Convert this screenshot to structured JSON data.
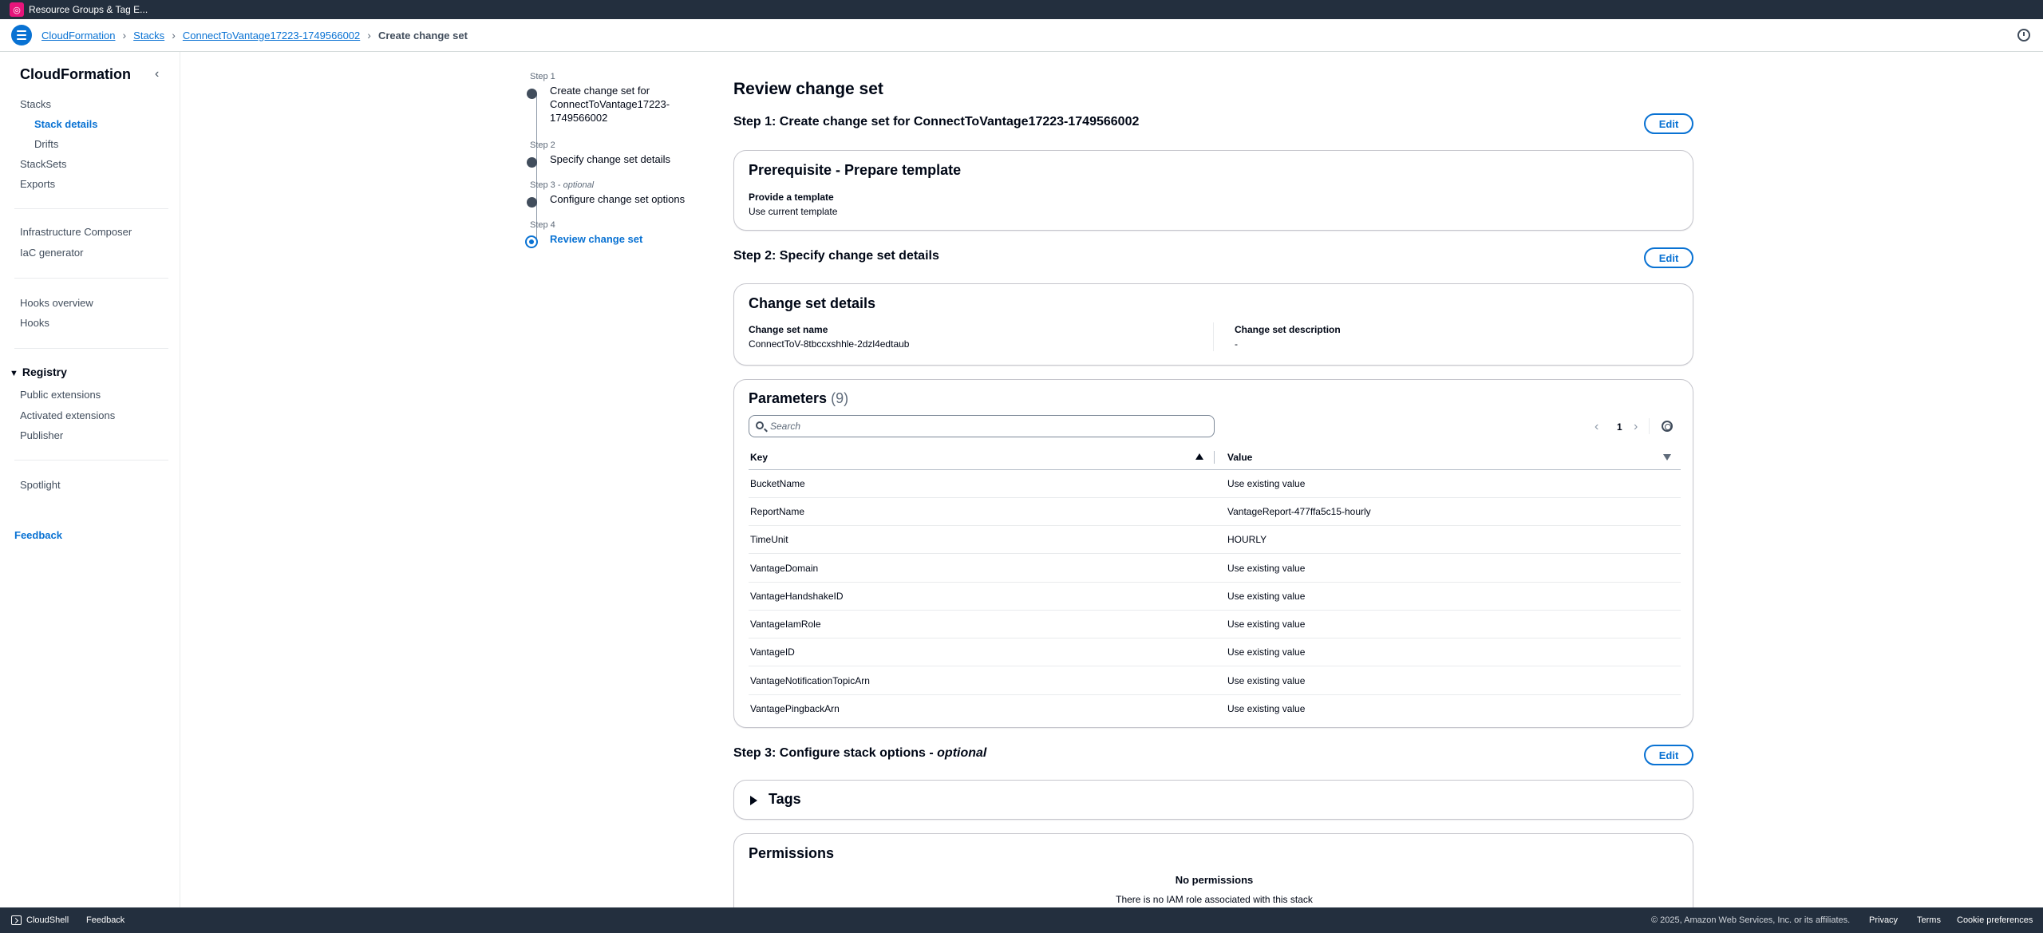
{
  "topbar": {
    "service_label": "Resource Groups & Tag E..."
  },
  "breadcrumb": {
    "items": [
      "CloudFormation",
      "Stacks",
      "ConnectToVantage17223-1749566002"
    ],
    "current": "Create change set"
  },
  "sidebar": {
    "title": "CloudFormation",
    "items": {
      "stacks": "Stacks",
      "stack_details": "Stack details",
      "drifts": "Drifts",
      "stacksets": "StackSets",
      "exports": "Exports",
      "infra_composer": "Infrastructure Composer",
      "iac_generator": "IaC generator",
      "hooks_overview": "Hooks overview",
      "hooks": "Hooks",
      "registry": "Registry",
      "public_extensions": "Public extensions",
      "activated_extensions": "Activated extensions",
      "publisher": "Publisher",
      "spotlight": "Spotlight"
    },
    "feedback": "Feedback"
  },
  "wizard": {
    "steps": [
      {
        "num": "Step 1",
        "name": "Create change set for ConnectToVantage17223-1749566002"
      },
      {
        "num": "Step 2",
        "name": "Specify change set details"
      },
      {
        "num": "Step 3",
        "optional": "optional",
        "name": "Configure change set options"
      },
      {
        "num": "Step 4",
        "name": "Review change set"
      }
    ]
  },
  "main": {
    "title": "Review change set",
    "edit_label": "Edit",
    "step1": {
      "header": "Step 1: Create change set for ConnectToVantage17223-1749566002",
      "card_title": "Prerequisite - Prepare template",
      "label": "Provide a template",
      "value": "Use current template"
    },
    "step2": {
      "header": "Step 2: Specify change set details",
      "card_title": "Change set details",
      "name_label": "Change set name",
      "name_value": "ConnectToV-8tbccxshhle-2dzl4edtaub",
      "desc_label": "Change set description",
      "desc_value": "-"
    },
    "parameters": {
      "title": "Parameters",
      "count": "(9)",
      "search_placeholder": "Search",
      "page": "1",
      "columns": [
        "Key",
        "Value"
      ],
      "rows": [
        {
          "key": "BucketName",
          "value": "Use existing value"
        },
        {
          "key": "ReportName",
          "value": "VantageReport-477ffa5c15-hourly"
        },
        {
          "key": "TimeUnit",
          "value": "HOURLY"
        },
        {
          "key": "VantageDomain",
          "value": "Use existing value"
        },
        {
          "key": "VantageHandshakeID",
          "value": "Use existing value"
        },
        {
          "key": "VantageIamRole",
          "value": "Use existing value"
        },
        {
          "key": "VantageID",
          "value": "Use existing value"
        },
        {
          "key": "VantageNotificationTopicArn",
          "value": "Use existing value"
        },
        {
          "key": "VantagePingbackArn",
          "value": "Use existing value"
        }
      ]
    },
    "step3": {
      "header": "Step 3: Configure stack options - ",
      "header_optional": "optional",
      "tags_title": "Tags",
      "permissions_title": "Permissions",
      "no_permissions": "No permissions",
      "no_permissions_desc": "There is no IAM role associated with this stack"
    }
  },
  "footer": {
    "cloudshell": "CloudShell",
    "feedback": "Feedback",
    "copyright": "© 2025, Amazon Web Services, Inc. or its affiliates.",
    "privacy": "Privacy",
    "terms": "Terms",
    "cookies": "Cookie preferences"
  }
}
